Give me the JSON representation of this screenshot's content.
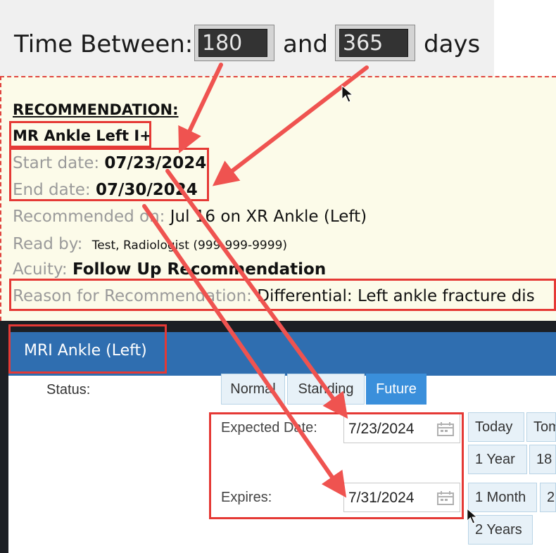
{
  "time_between": {
    "label": "Time Between:",
    "from_value": "180",
    "and_label": "and",
    "to_value": "365",
    "unit_label": "days"
  },
  "recommendation": {
    "heading": "RECOMMENDATION:",
    "exam": "MR Ankle Left I+",
    "start_label": "Start date:",
    "start_value": "07/23/2024",
    "end_label": "End date:",
    "end_value": "07/30/2024",
    "recommended_on_label": "Recommended on:",
    "recommended_on_value": "Jul 16 on XR Ankle (Left)",
    "read_by_label": "Read by:",
    "read_by_value": "Test, Radiologist (999-999-9999)",
    "acuity_label": "Acuity:",
    "acuity_value": "Follow Up Recommendation",
    "reason_label": "Reason for Recommendation:",
    "reason_value": "Differential: Left ankle fracture dis"
  },
  "order": {
    "title": "MRI Ankle (Left)",
    "status_label": "Status:",
    "status_options": [
      "Normal",
      "Standing",
      "Future"
    ],
    "status_selected": "Future",
    "expected_label": "Expected Date:",
    "expected_value": "7/23/2024",
    "expires_label": "Expires:",
    "expires_value": "7/31/2024",
    "quick_buttons": [
      "Today",
      "Tom",
      "1 Year",
      "18",
      "1 Month",
      "2",
      "2 Years"
    ]
  },
  "colors": {
    "annotation_red": "#e53935",
    "header_blue": "#2f6eb0",
    "active_blue": "#3a8fdb",
    "note_background": "#fcfbe9"
  },
  "icons": [
    "calendar-icon",
    "mouse-pointer-icon",
    "annotation-arrow"
  ]
}
